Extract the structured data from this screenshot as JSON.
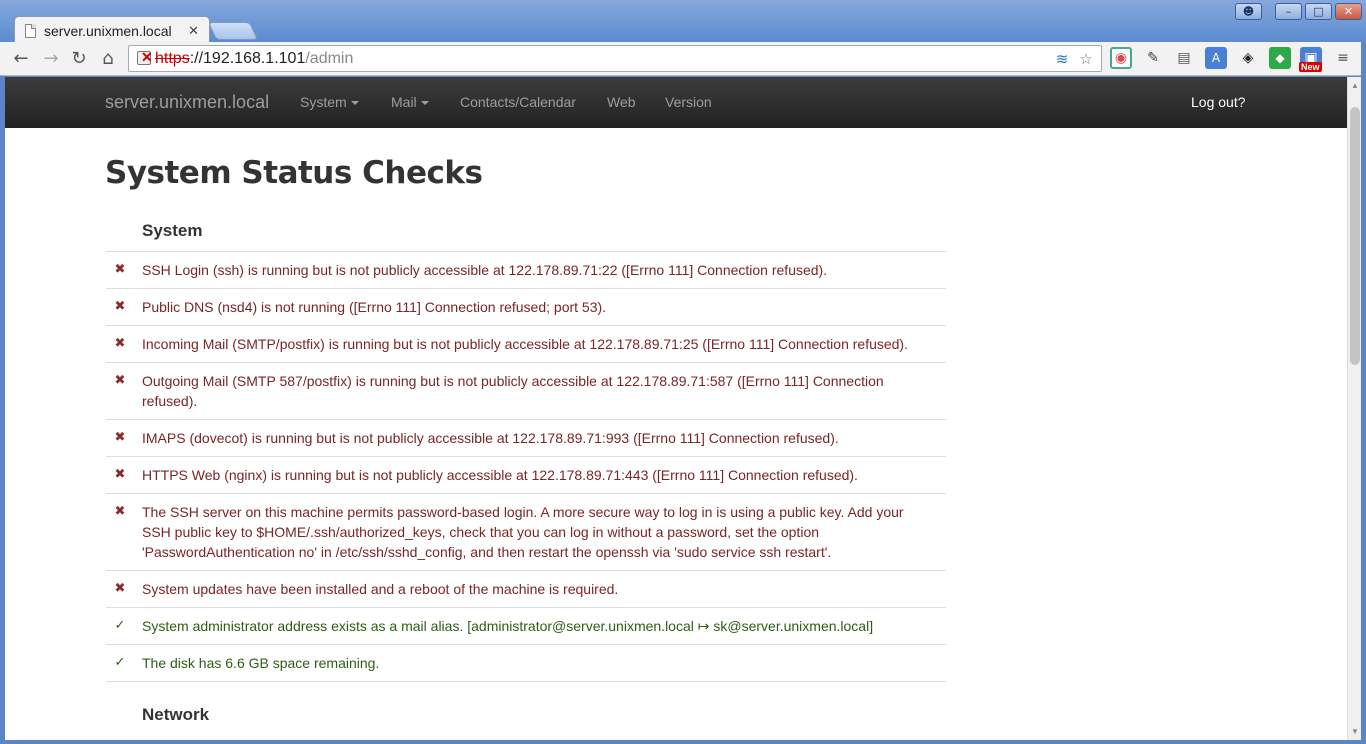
{
  "browser": {
    "tab_title": "server.unixmen.local",
    "url_scheme": "https",
    "url_host": "://192.168.1.101",
    "url_path": "/admin",
    "new_badge": "New"
  },
  "navbar": {
    "brand": "server.unixmen.local",
    "items": [
      {
        "label": "System",
        "dropdown": true
      },
      {
        "label": "Mail",
        "dropdown": true
      },
      {
        "label": "Contacts/Calendar",
        "dropdown": false
      },
      {
        "label": "Web",
        "dropdown": false
      },
      {
        "label": "Version",
        "dropdown": false
      }
    ],
    "logout": "Log out?"
  },
  "page": {
    "title": "System Status Checks",
    "sections": [
      {
        "heading": "System",
        "checks": [
          {
            "status": "fail",
            "text": "SSH Login (ssh) is running but is not publicly accessible at 122.178.89.71:22 ([Errno 111] Connection refused)."
          },
          {
            "status": "fail",
            "text": "Public DNS (nsd4) is not running ([Errno 111] Connection refused; port 53)."
          },
          {
            "status": "fail",
            "text": "Incoming Mail (SMTP/postfix) is running but is not publicly accessible at 122.178.89.71:25 ([Errno 111] Connection refused)."
          },
          {
            "status": "fail",
            "text": "Outgoing Mail (SMTP 587/postfix) is running but is not publicly accessible at 122.178.89.71:587 ([Errno 111] Connection refused)."
          },
          {
            "status": "fail",
            "text": "IMAPS (dovecot) is running but is not publicly accessible at 122.178.89.71:993 ([Errno 111] Connection refused)."
          },
          {
            "status": "fail",
            "text": "HTTPS Web (nginx) is running but is not publicly accessible at 122.178.89.71:443 ([Errno 111] Connection refused)."
          },
          {
            "status": "fail",
            "text": "The SSH server on this machine permits password-based login. A more secure way to log in is using a public key. Add your SSH public key to $HOME/.ssh/authorized_keys, check that you can log in without a password, set the option 'PasswordAuthentication no' in /etc/ssh/sshd_config, and then restart the openssh via 'sudo service ssh restart'."
          },
          {
            "status": "fail",
            "text": "System updates have been installed and a reboot of the machine is required."
          },
          {
            "status": "ok",
            "text": "System administrator address exists as a mail alias. [administrator@server.unixmen.local ↦ sk@server.unixmen.local]"
          },
          {
            "status": "ok",
            "text": "The disk has 6.6 GB space remaining."
          }
        ]
      },
      {
        "heading": "Network",
        "checks": []
      }
    ]
  },
  "icons": {
    "fail_mark": "✖",
    "ok_mark": "✓"
  },
  "colors": {
    "fail_text": "#7b2525",
    "ok_text": "#2d5e16",
    "navbar_bg": "#222222"
  }
}
